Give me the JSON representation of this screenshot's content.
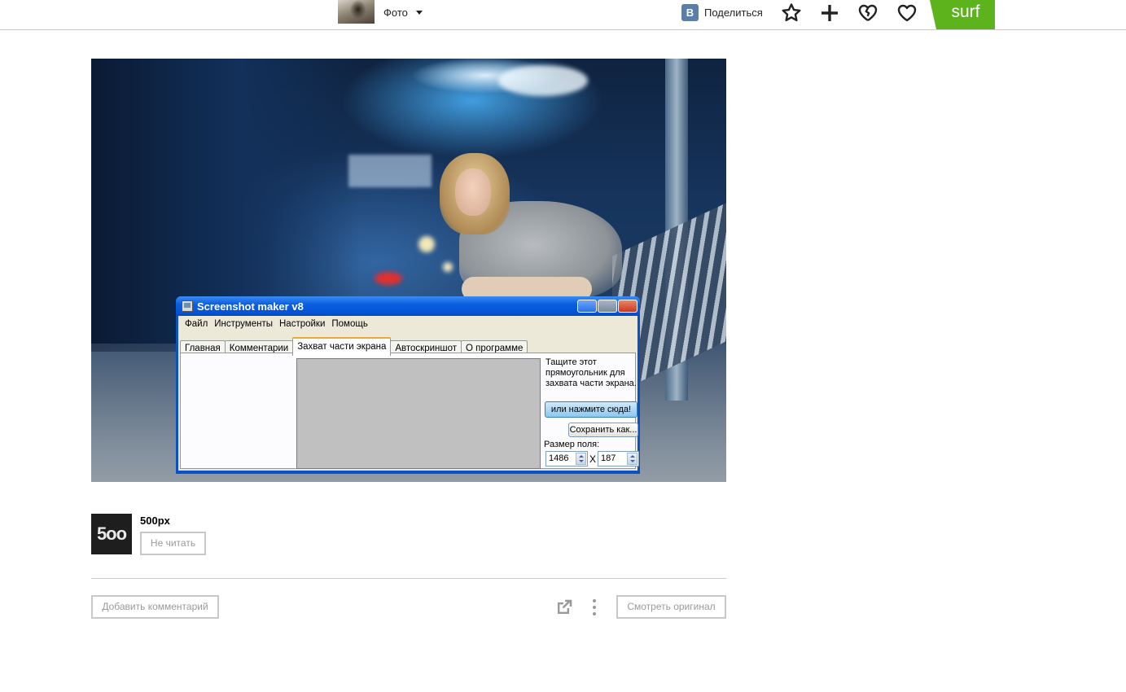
{
  "topbar": {
    "section_label": "Фото",
    "share_label": "Поделиться",
    "vk_letter": "В",
    "surf_label": "surf",
    "icons": [
      "star-icon",
      "plus-icon",
      "broken-heart-icon",
      "heart-icon"
    ],
    "accent_color": "#5cb31b"
  },
  "screenshot_window": {
    "title": "Screenshot maker v8",
    "menu": [
      "Файл",
      "Инструменты",
      "Настройки",
      "Помощь"
    ],
    "tabs": [
      "Главная",
      "Комментарии",
      "Захват части экрана",
      "Автоскриншот",
      "О программе"
    ],
    "active_tab": "Захват части экрана",
    "hint": "Тащите этот прямоугольник для захвата части экрана.",
    "capture_button": "или нажмите сюда!",
    "save_button": "Сохранить как...",
    "size_label": "Размер поля:",
    "width_value": "1486",
    "separator": "X",
    "height_value": "187"
  },
  "author": {
    "avatar_text": "5oo",
    "name": "500px",
    "follow_label": "Не читать"
  },
  "footer": {
    "comment_label": "Добавить комментарий",
    "original_label": "Смотреть оригинал"
  }
}
